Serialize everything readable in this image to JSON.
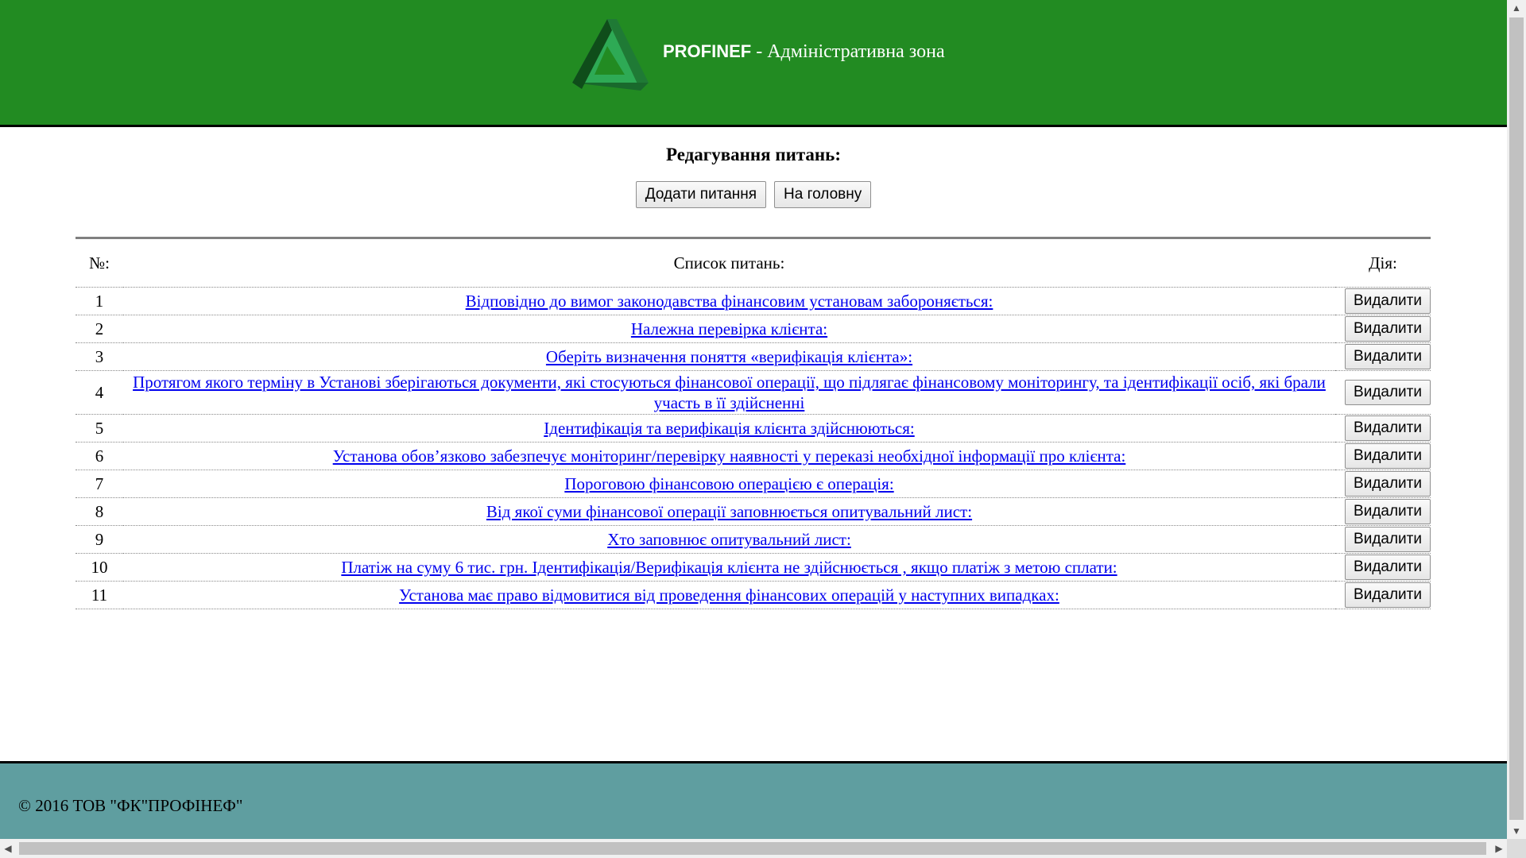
{
  "header": {
    "brand_name": "PROFINEF",
    "brand_suffix": " - Адміністративна зона",
    "colors": {
      "background": "#228b22",
      "logo_dark": "#0f4d1a",
      "logo_light": "#2eaa55"
    }
  },
  "main": {
    "title": "Редагування питань:",
    "buttons": {
      "add_question": "Додати питання",
      "home": "На головну"
    },
    "table": {
      "headers": {
        "number": "№:",
        "list": "Список питань:",
        "action": "Дія:"
      },
      "delete_label": "Видалити",
      "rows": [
        {
          "num": "1",
          "question": "Відповідно до вимог законодавства фінансовим установам забороняється:"
        },
        {
          "num": "2",
          "question": "Належна перевірка клієнта:"
        },
        {
          "num": "3",
          "question": "Оберіть визначення поняття «верифікація клієнта»:"
        },
        {
          "num": "4",
          "question": "Протягом якого терміну в Установі зберігаються документи, які стосуються фінансової операції, що підлягає фінансовому моніторингу, та ідентифікації осіб, які брали участь в її здійсненні"
        },
        {
          "num": "5",
          "question": "Ідентифікація та верифікація клієнта здійснюються:"
        },
        {
          "num": "6",
          "question": "Установа обов’язково забезпечує моніторинг/перевірку наявності у переказі необхідної інформації про клієнта:"
        },
        {
          "num": "7",
          "question": "Пороговою фінансовою операцією є операція:"
        },
        {
          "num": "8",
          "question": "Від якої суми фінансової операції заповнюється опитувальний лист:"
        },
        {
          "num": "9",
          "question": "Хто заповнює опитувальний лист:"
        },
        {
          "num": "10",
          "question": "Платіж на суму 6 тис. грн. Ідентифікація/Верифікація клієнта не здійснюється , якщо платіж з метою сплати:"
        },
        {
          "num": "11",
          "question": "Установа має право відмовитися від проведення фінансових операцій у наступних випадках:"
        }
      ]
    }
  },
  "footer": {
    "copyright": "© 2016 ТОВ \"ФК\"ПРОФІНЕФ\"",
    "background": "#5f9ea0"
  },
  "scrollbars": {
    "up": "▲",
    "down": "▼",
    "left": "◀",
    "right": "▶"
  }
}
